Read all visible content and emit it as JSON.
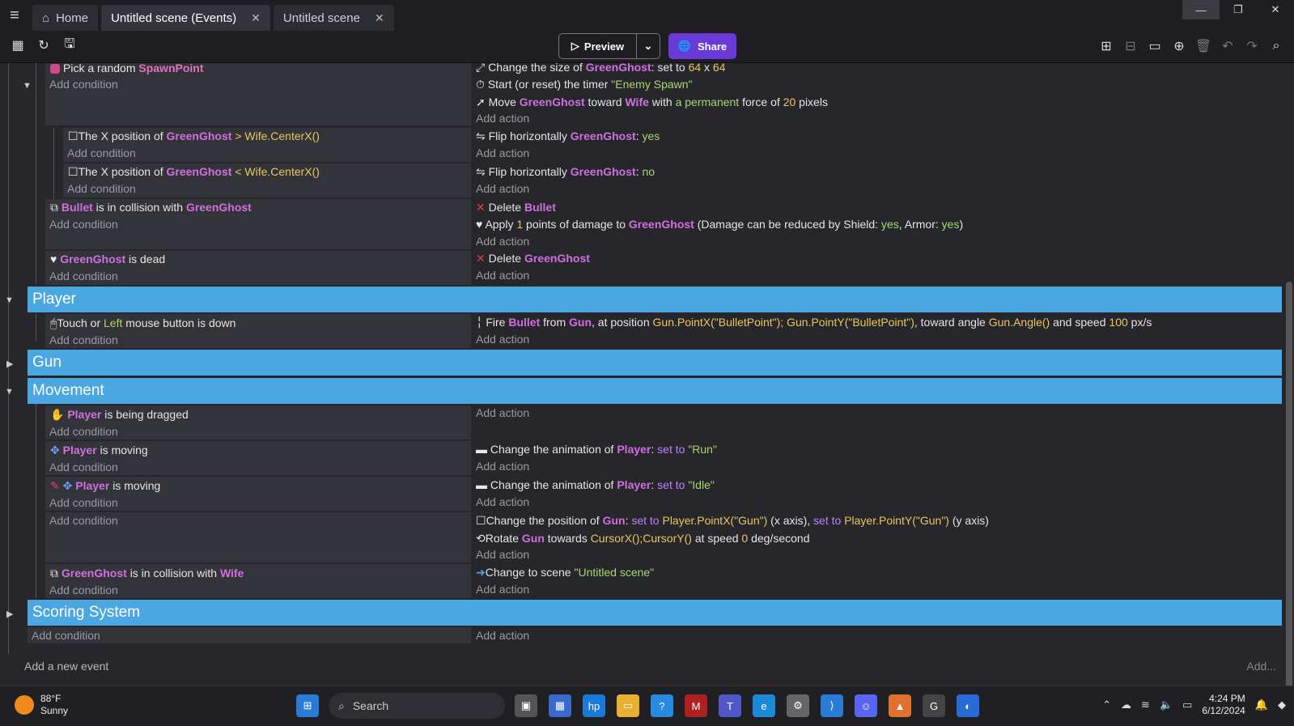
{
  "titlebar": {
    "tabs": [
      {
        "label": "Home"
      },
      {
        "label": "Untitled scene (Events)"
      },
      {
        "label": "Untitled scene"
      }
    ]
  },
  "toolbar": {
    "preview": "Preview",
    "share": "Share"
  },
  "events": {
    "e1": {
      "c1a": "Pick a random",
      "c1b": "SpawnPoint",
      "add_condition": "Add condition",
      "a1a": "Change the size of",
      "a1b": "GreenGhost",
      "a1c": ": set to",
      "a1d": "64",
      "a1e": "x",
      "a1f": "64",
      "a2a": "Start (or reset) the timer",
      "a2b": "\"Enemy Spawn\"",
      "a3a": "Move",
      "a3b": "GreenGhost",
      "a3c": "toward",
      "a3d": "Wife",
      "a3e": "with",
      "a3f": "a permanent",
      "a3g": "force of",
      "a3h": "20",
      "a3i": "pixels",
      "add_action": "Add action"
    },
    "e2": {
      "c1": "The X position of",
      "c2": "GreenGhost",
      "c3": ">",
      "c4": "Wife.CenterX()",
      "a1": "Flip horizontally",
      "a2": "GreenGhost",
      "a3": ":",
      "a4": "yes"
    },
    "e3": {
      "c1": "The X position of",
      "c2": "GreenGhost",
      "c3": "<",
      "c4": "Wife.CenterX()",
      "a1": "Flip horizontally",
      "a2": "GreenGhost",
      "a3": ":",
      "a4": "no"
    },
    "e4": {
      "c1": "Bullet",
      "c2": "is in collision with",
      "c3": "GreenGhost",
      "a1a": "Delete",
      "a1b": "Bullet",
      "a2a": "Apply",
      "a2b": "1",
      "a2c": "points of damage to",
      "a2d": "GreenGhost",
      "a2e": "(Damage can be reduced by Shield:",
      "a2f": "yes",
      "a2g": ", Armor:",
      "a2h": "yes",
      "a2i": ")"
    },
    "e5": {
      "c1": "GreenGhost",
      "c2": "is dead",
      "a1": "Delete",
      "a2": "GreenGhost"
    },
    "g_player": "Player",
    "e6": {
      "c1": "Touch or",
      "c2": "Left",
      "c3": "mouse button is down",
      "a1": "Fire",
      "a2": "Bullet",
      "a3": "from",
      "a4": "Gun",
      "a5": ", at position",
      "a6": "Gun.PointX(\"BulletPoint\"); Gun.PointY(\"BulletPoint\")",
      "a7": ", toward angle",
      "a8": "Gun.Angle()",
      "a9": "and speed",
      "a10": "100",
      "a11": "px/s"
    },
    "g_gun": "Gun",
    "g_movement": "Movement",
    "e7": {
      "c1": "Player",
      "c2": "is being dragged"
    },
    "e8": {
      "c1": "Player",
      "c2": "is moving",
      "a1": "Change the animation of",
      "a2": "Player",
      "a3": ":",
      "a4": "set to",
      "a5": "\"Run\""
    },
    "e9": {
      "c1": "Player",
      "c2": "is moving",
      "a1": "Change the animation of",
      "a2": "Player",
      "a3": ":",
      "a4": "set to",
      "a5": "\"Idle\""
    },
    "e10": {
      "a1a": "Change the position of",
      "a1b": "Gun",
      "a1c": ":",
      "a1d": "set to",
      "a1e": "Player.PointX(\"Gun\")",
      "a1f": "(x axis),",
      "a1g": "set to",
      "a1h": "Player.PointY(\"Gun\")",
      "a1i": "(y axis)",
      "a2a": "Rotate",
      "a2b": "Gun",
      "a2c": "towards",
      "a2d": "CursorX();CursorY()",
      "a2e": "at speed",
      "a2f": "0",
      "a2g": "deg/second"
    },
    "e11": {
      "c1": "GreenGhost",
      "c2": "is in collision with",
      "c3": "Wife",
      "a1": "Change to scene",
      "a2": "\"Untitled scene\""
    },
    "g_scoring": "Scoring System",
    "add_new_event": "Add a new event",
    "add_more": "Add..."
  },
  "taskbar": {
    "temp": "88°F",
    "weather": "Sunny",
    "search": "Search",
    "time": "4:24 PM",
    "date": "6/12/2024"
  },
  "colors": {
    "group": "#4aa7e2",
    "object": "#d070e0",
    "value": "#e8c860",
    "string": "#a8d870",
    "share": "#6a3ad8"
  }
}
